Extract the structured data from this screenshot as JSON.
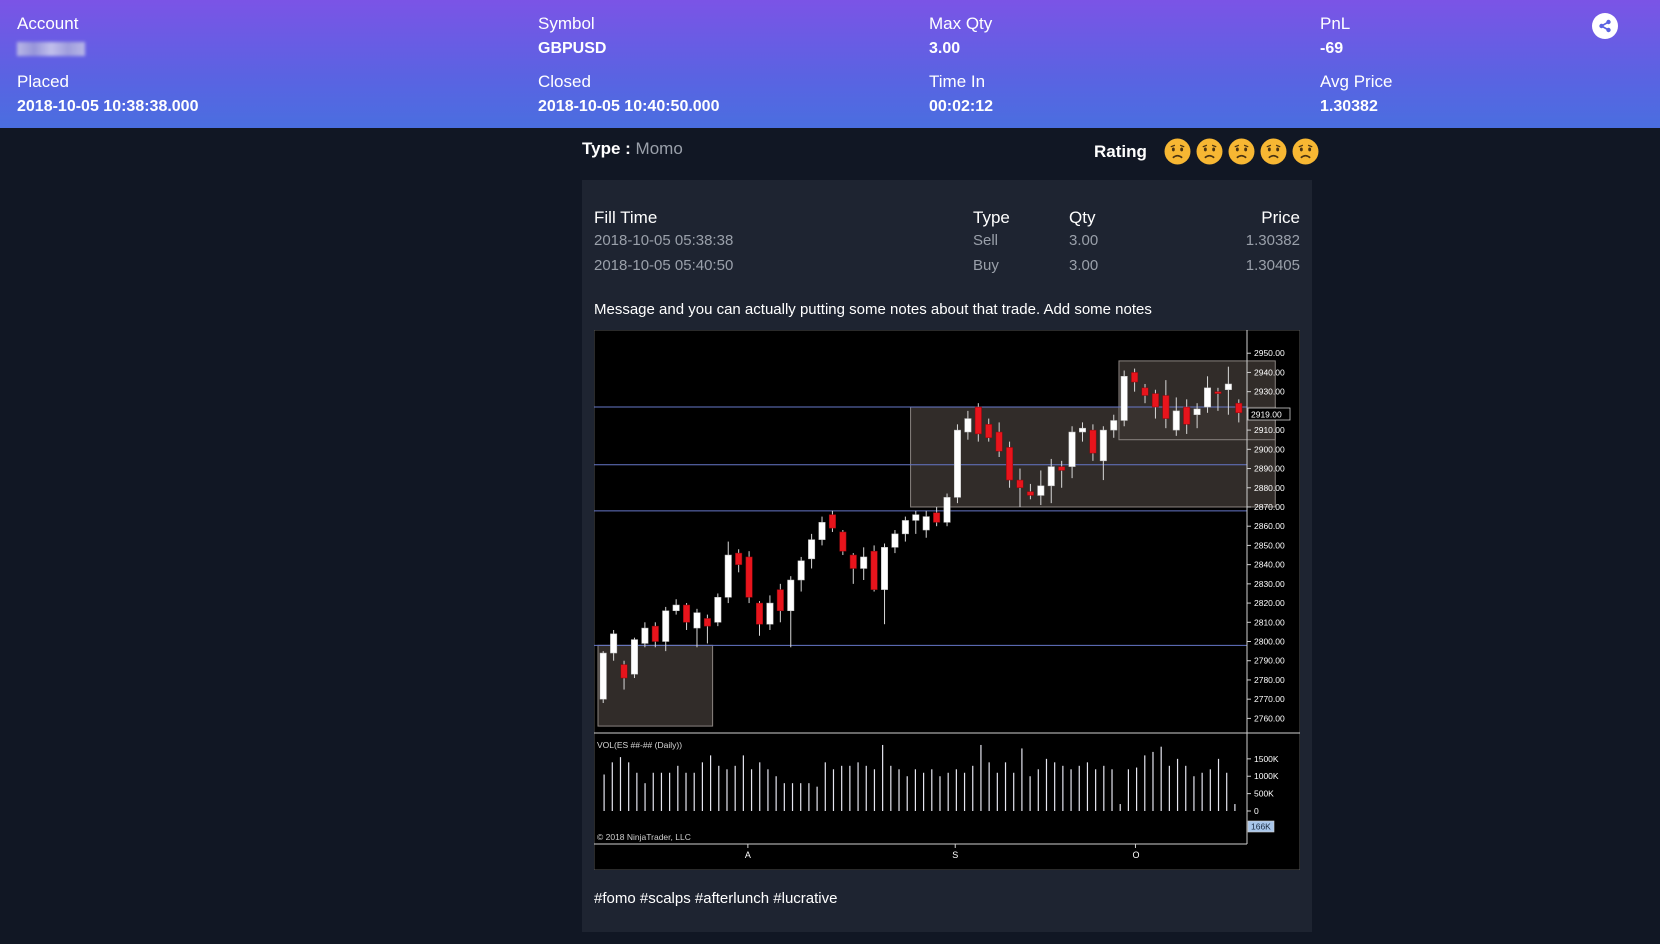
{
  "header": {
    "account": {
      "label": "Account"
    },
    "symbol": {
      "label": "Symbol",
      "value": "GBPUSD"
    },
    "max_qty": {
      "label": "Max Qty",
      "value": "3.00"
    },
    "pnl": {
      "label": "PnL",
      "value": "-69"
    },
    "placed": {
      "label": "Placed",
      "value": "2018-10-05 10:38:38.000"
    },
    "closed": {
      "label": "Closed",
      "value": "2018-10-05 10:40:50.000"
    },
    "time_in": {
      "label": "Time In",
      "value": "00:02:12"
    },
    "avg_price": {
      "label": "Avg Price",
      "value": "1.30382"
    },
    "share_icon": "share-icon"
  },
  "trade": {
    "type_label": "Type :",
    "type_value": "Momo",
    "rating_label": "Rating",
    "rating_icons": [
      "sad-face-icon",
      "sad-face-icon",
      "sad-face-icon",
      "sad-face-icon",
      "sad-face-icon"
    ]
  },
  "fills": {
    "headers": [
      "Fill Time",
      "Type",
      "Qty",
      "Price"
    ],
    "rows": [
      [
        "2018-10-05 05:38:38",
        "Sell",
        "3.00",
        "1.30382"
      ],
      [
        "2018-10-05 05:40:50",
        "Buy",
        "3.00",
        "1.30405"
      ]
    ]
  },
  "message": "Message and you can actually putting some notes about that trade. Add some notes",
  "chart_data": {
    "type": "candlestick",
    "y_ticks": [
      "2950.00",
      "2940.00",
      "2930.00",
      "2920.00",
      "2910.00",
      "2900.00",
      "2890.00",
      "2880.00",
      "2870.00",
      "2860.00",
      "2850.00",
      "2840.00",
      "2830.00",
      "2820.00",
      "2810.00",
      "2800.00",
      "2790.00",
      "2780.00",
      "2770.00",
      "2760.00"
    ],
    "current_price": "2919.00",
    "ylim": [
      2755,
      2960
    ],
    "x_ticks": [
      "A",
      "S",
      "O"
    ],
    "horizontal_lines": [
      2922,
      2892,
      2868,
      2798
    ],
    "zones": [
      {
        "from_index": 0,
        "to_index": 11,
        "low": 2756,
        "high": 2798
      },
      {
        "from_index": 30,
        "to_index": 65,
        "low": 2870,
        "high": 2922
      },
      {
        "from_index": 50,
        "to_index": 65,
        "low": 2905,
        "high": 2946
      }
    ],
    "candles": [
      {
        "o": 2770,
        "h": 2795,
        "l": 2768,
        "c": 2794
      },
      {
        "o": 2794,
        "h": 2806,
        "l": 2790,
        "c": 2804
      },
      {
        "o": 2788,
        "h": 2790,
        "l": 2775,
        "c": 2781
      },
      {
        "o": 2783,
        "h": 2802,
        "l": 2781,
        "c": 2801
      },
      {
        "o": 2799,
        "h": 2810,
        "l": 2797,
        "c": 2807
      },
      {
        "o": 2808,
        "h": 2810,
        "l": 2797,
        "c": 2800
      },
      {
        "o": 2800,
        "h": 2818,
        "l": 2795,
        "c": 2816
      },
      {
        "o": 2816,
        "h": 2822,
        "l": 2814,
        "c": 2819
      },
      {
        "o": 2819,
        "h": 2820,
        "l": 2806,
        "c": 2810
      },
      {
        "o": 2807,
        "h": 2817,
        "l": 2797,
        "c": 2815
      },
      {
        "o": 2812,
        "h": 2814,
        "l": 2799,
        "c": 2808
      },
      {
        "o": 2810,
        "h": 2825,
        "l": 2808,
        "c": 2823
      },
      {
        "o": 2823,
        "h": 2852,
        "l": 2820,
        "c": 2845
      },
      {
        "o": 2846,
        "h": 2848,
        "l": 2836,
        "c": 2840
      },
      {
        "o": 2844,
        "h": 2847,
        "l": 2820,
        "c": 2823
      },
      {
        "o": 2820,
        "h": 2821,
        "l": 2803,
        "c": 2809
      },
      {
        "o": 2809,
        "h": 2824,
        "l": 2806,
        "c": 2820
      },
      {
        "o": 2827,
        "h": 2830,
        "l": 2810,
        "c": 2816
      },
      {
        "o": 2816,
        "h": 2834,
        "l": 2797,
        "c": 2832
      },
      {
        "o": 2832,
        "h": 2844,
        "l": 2826,
        "c": 2842
      },
      {
        "o": 2843,
        "h": 2856,
        "l": 2838,
        "c": 2853
      },
      {
        "o": 2853,
        "h": 2865,
        "l": 2850,
        "c": 2862
      },
      {
        "o": 2866,
        "h": 2868,
        "l": 2857,
        "c": 2859
      },
      {
        "o": 2857,
        "h": 2858,
        "l": 2845,
        "c": 2847
      },
      {
        "o": 2845,
        "h": 2846,
        "l": 2830,
        "c": 2838
      },
      {
        "o": 2838,
        "h": 2849,
        "l": 2832,
        "c": 2844
      },
      {
        "o": 2847,
        "h": 2850,
        "l": 2826,
        "c": 2827
      },
      {
        "o": 2827,
        "h": 2851,
        "l": 2809,
        "c": 2849
      },
      {
        "o": 2849,
        "h": 2858,
        "l": 2846,
        "c": 2856
      },
      {
        "o": 2856,
        "h": 2865,
        "l": 2852,
        "c": 2863
      },
      {
        "o": 2863,
        "h": 2868,
        "l": 2856,
        "c": 2866
      },
      {
        "o": 2858,
        "h": 2868,
        "l": 2854,
        "c": 2865
      },
      {
        "o": 2867,
        "h": 2870,
        "l": 2860,
        "c": 2862
      },
      {
        "o": 2862,
        "h": 2877,
        "l": 2860,
        "c": 2875
      },
      {
        "o": 2875,
        "h": 2913,
        "l": 2872,
        "c": 2910
      },
      {
        "o": 2909,
        "h": 2920,
        "l": 2905,
        "c": 2916
      },
      {
        "o": 2922,
        "h": 2924,
        "l": 2904,
        "c": 2908
      },
      {
        "o": 2913,
        "h": 2916,
        "l": 2904,
        "c": 2906
      },
      {
        "o": 2909,
        "h": 2914,
        "l": 2896,
        "c": 2899
      },
      {
        "o": 2901,
        "h": 2904,
        "l": 2880,
        "c": 2884
      },
      {
        "o": 2884,
        "h": 2890,
        "l": 2870,
        "c": 2880
      },
      {
        "o": 2878,
        "h": 2882,
        "l": 2874,
        "c": 2876
      },
      {
        "o": 2876,
        "h": 2889,
        "l": 2871,
        "c": 2881
      },
      {
        "o": 2881,
        "h": 2895,
        "l": 2872,
        "c": 2891
      },
      {
        "o": 2891,
        "h": 2894,
        "l": 2880,
        "c": 2889
      },
      {
        "o": 2891,
        "h": 2912,
        "l": 2885,
        "c": 2909
      },
      {
        "o": 2909,
        "h": 2914,
        "l": 2904,
        "c": 2911
      },
      {
        "o": 2910,
        "h": 2913,
        "l": 2894,
        "c": 2898
      },
      {
        "o": 2894,
        "h": 2912,
        "l": 2884,
        "c": 2910
      },
      {
        "o": 2910,
        "h": 2918,
        "l": 2906,
        "c": 2915
      },
      {
        "o": 2915,
        "h": 2941,
        "l": 2912,
        "c": 2938
      },
      {
        "o": 2940,
        "h": 2942,
        "l": 2930,
        "c": 2935
      },
      {
        "o": 2932,
        "h": 2934,
        "l": 2924,
        "c": 2928
      },
      {
        "o": 2929,
        "h": 2931,
        "l": 2916,
        "c": 2922
      },
      {
        "o": 2928,
        "h": 2936,
        "l": 2911,
        "c": 2916
      },
      {
        "o": 2910,
        "h": 2927,
        "l": 2907,
        "c": 2920
      },
      {
        "o": 2922,
        "h": 2926,
        "l": 2908,
        "c": 2913
      },
      {
        "o": 2918,
        "h": 2924,
        "l": 2911,
        "c": 2921
      },
      {
        "o": 2922,
        "h": 2938,
        "l": 2919,
        "c": 2932
      },
      {
        "o": 2930,
        "h": 2932,
        "l": 2920,
        "c": 2929
      },
      {
        "o": 2931,
        "h": 2943,
        "l": 2918,
        "c": 2934
      },
      {
        "o": 2924,
        "h": 2926,
        "l": 2914,
        "c": 2919
      }
    ],
    "volume": {
      "label": "VOL(ES ##-## (Daily))",
      "y_ticks": [
        "1500K",
        "1000K",
        "500K",
        "0"
      ],
      "current_value": "166K",
      "ylim": [
        0,
        2100
      ],
      "values": [
        1050,
        1400,
        1550,
        1400,
        1100,
        800,
        1100,
        1100,
        1100,
        1300,
        1100,
        1100,
        1400,
        1600,
        1300,
        1200,
        1300,
        1600,
        1200,
        1400,
        1200,
        1000,
        800,
        800,
        800,
        800,
        700,
        1400,
        1200,
        1300,
        1300,
        1400,
        1300,
        1200,
        1900,
        1300,
        1200,
        1000,
        1200,
        1100,
        1200,
        1000,
        1100,
        1200,
        1100,
        1300,
        1900,
        1400,
        1100,
        1400,
        1100,
        1800,
        1000,
        1200,
        1500,
        1400,
        1300,
        1200,
        1300,
        1400,
        1200,
        1300,
        1200,
        200,
        1200,
        1250,
        1600,
        1700,
        1850,
        1300,
        1500,
        1300,
        1000,
        1100,
        1200,
        1500,
        1100,
        200
      ]
    },
    "copyright": "© 2018 NinjaTrader, LLC"
  },
  "tags": "#fomo #scalps #afterlunch #lucrative",
  "colors": {
    "header_gradient_start": "#7b54e6",
    "header_gradient_end": "#4a6ee0",
    "page_bg": "#111724",
    "card_bg": "#1e2431",
    "muted_text": "#9aa0aa",
    "candle_up": "#ffffff",
    "candle_down": "#e8141c",
    "zone_fill": "#3a3430",
    "level_line": "#6677c8"
  }
}
